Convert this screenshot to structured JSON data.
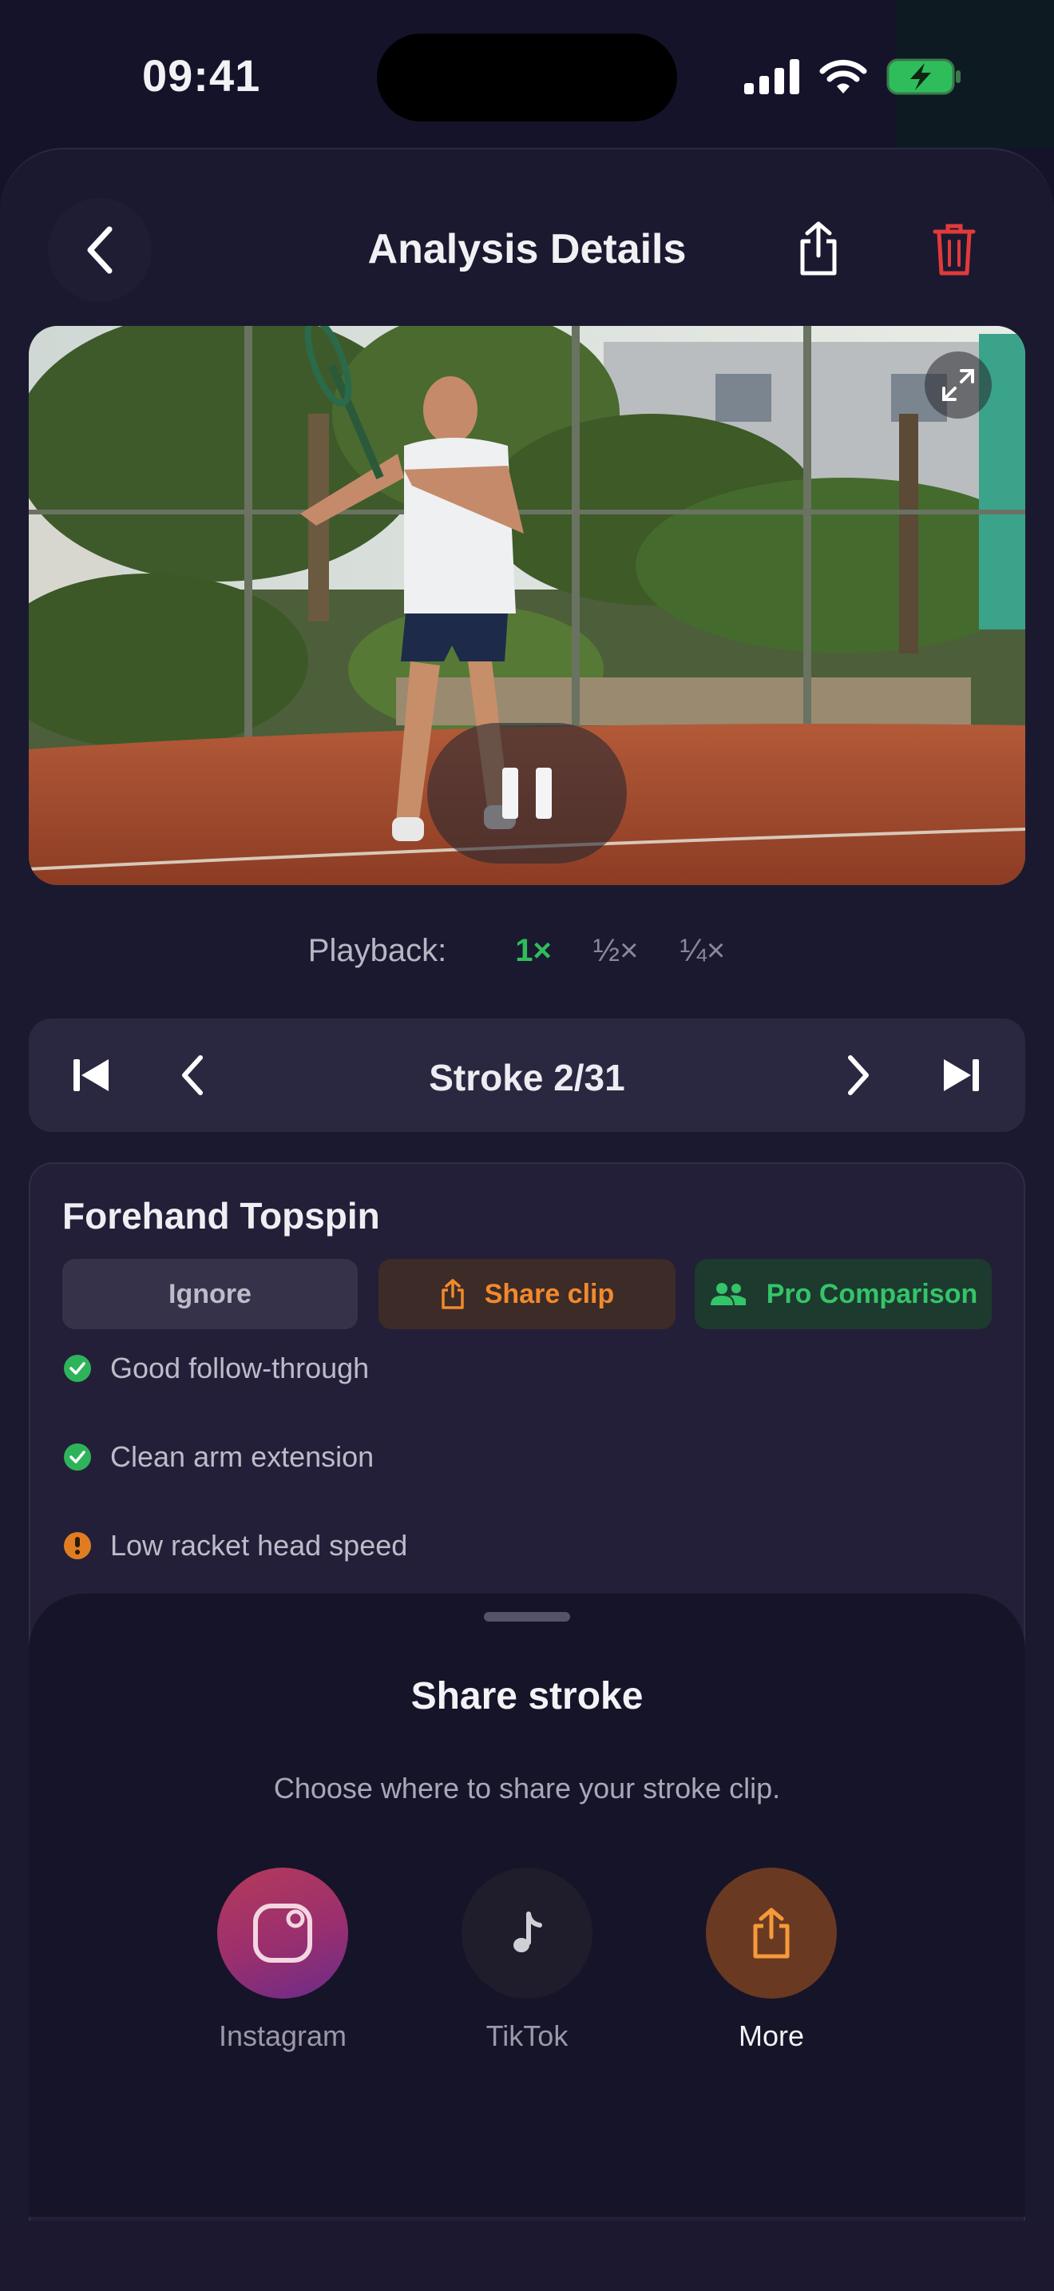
{
  "status_bar": {
    "time": "09:41"
  },
  "header": {
    "title": "Analysis Details"
  },
  "video": {
    "state": "playing"
  },
  "playback": {
    "label": "Playback:",
    "speeds": [
      "1×",
      "½×",
      "¼×"
    ],
    "selected": "1×"
  },
  "stroke_nav": {
    "label": "Stroke 2/31"
  },
  "analysis": {
    "stroke_type": "Forehand Topspin",
    "buttons": {
      "ignore": "Ignore",
      "share": "Share clip",
      "pro": "Pro Comparison"
    },
    "feedback": [
      {
        "text": "Good follow-through",
        "status": "ok"
      },
      {
        "text": "Clean arm extension",
        "status": "ok"
      },
      {
        "text": "Low racket head speed",
        "status": "warn"
      }
    ]
  },
  "share_sheet": {
    "title": "Share stroke",
    "subtitle": "Choose where to share your stroke clip.",
    "options": [
      {
        "label": "Instagram",
        "icon": "instagram-icon"
      },
      {
        "label": "TikTok",
        "icon": "tiktok-icon"
      },
      {
        "label": "More",
        "icon": "share-icon"
      }
    ]
  },
  "colors": {
    "accent_green": "#2fbd5c",
    "accent_orange": "#f08a2c",
    "danger_red": "#e23a3a"
  }
}
